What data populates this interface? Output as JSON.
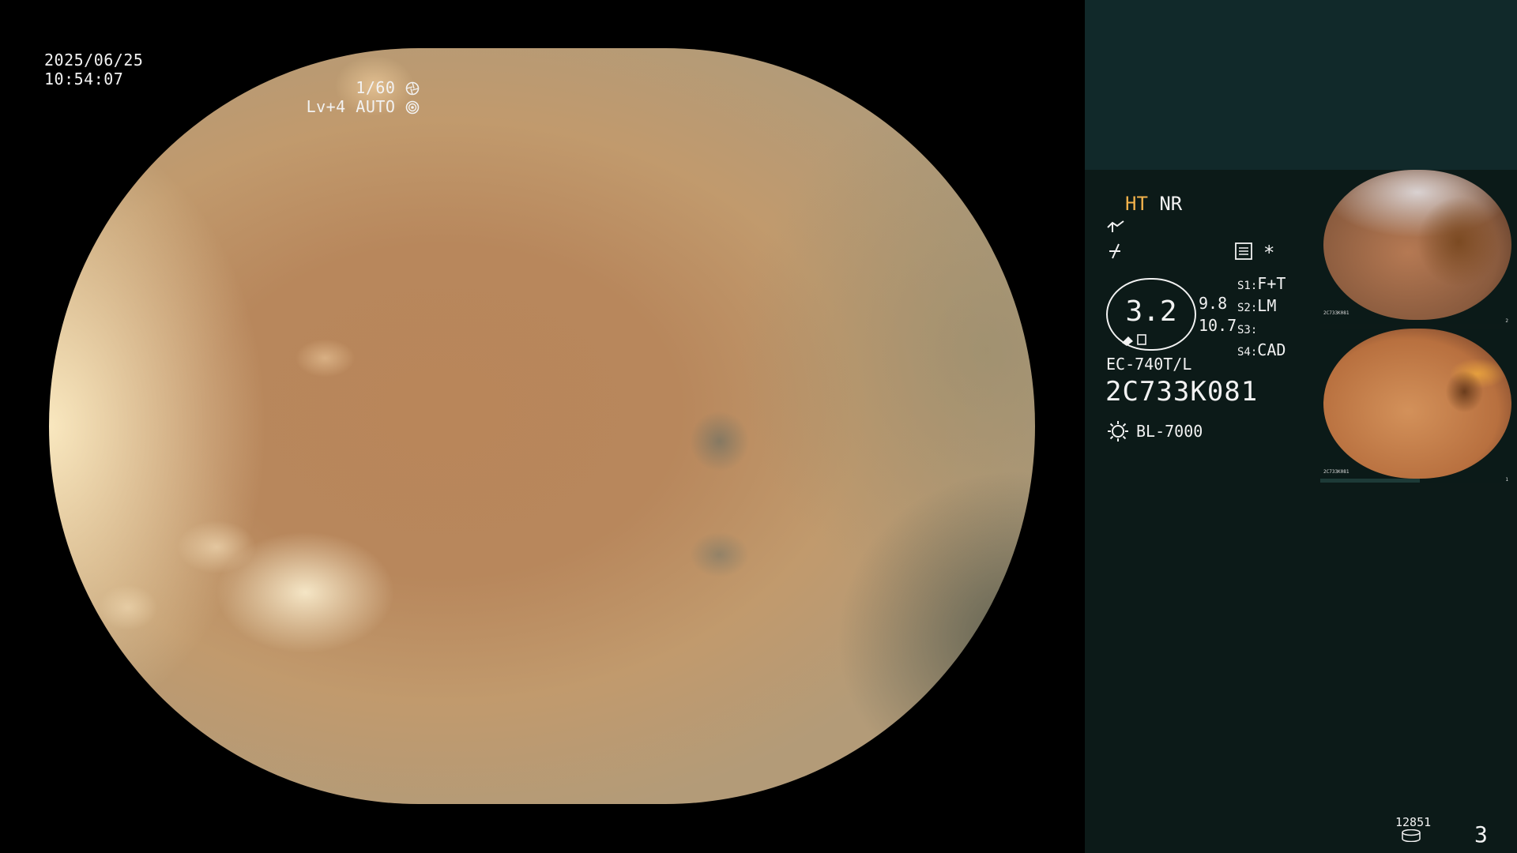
{
  "overlay": {
    "date": "2025/06/25",
    "time": "10:54:07",
    "shutter": "1/60",
    "level": "Lv+4",
    "iris_mode": "AUTO"
  },
  "modes": {
    "ht": "HT",
    "nr": "NR"
  },
  "gauge": {
    "value": "3.2",
    "upper": "9.8",
    "lower": "10.7"
  },
  "settings": {
    "asterisk": "*",
    "s1_key": "S1:",
    "s1_val": "F+T",
    "s2_key": "S2:",
    "s2_val": "LM",
    "s3_key": "S3:",
    "s3_val": "",
    "s4_key": "S4:",
    "s4_val": "CAD"
  },
  "device": {
    "model": "EC-740T/L",
    "serial": "2C733K081",
    "light_source": "BL-7000"
  },
  "thumbnails": [
    {
      "id_label": "2C733K081",
      "index": "2"
    },
    {
      "id_label": "2C733K081",
      "index": "1"
    }
  ],
  "footer": {
    "storage_count": "12851",
    "page_number": "3"
  },
  "icons": [
    "shutter-icon",
    "iris-icon",
    "enhance-icon",
    "gamma-icon",
    "menu-icon",
    "lightbulb-icon",
    "disk-icon"
  ]
}
